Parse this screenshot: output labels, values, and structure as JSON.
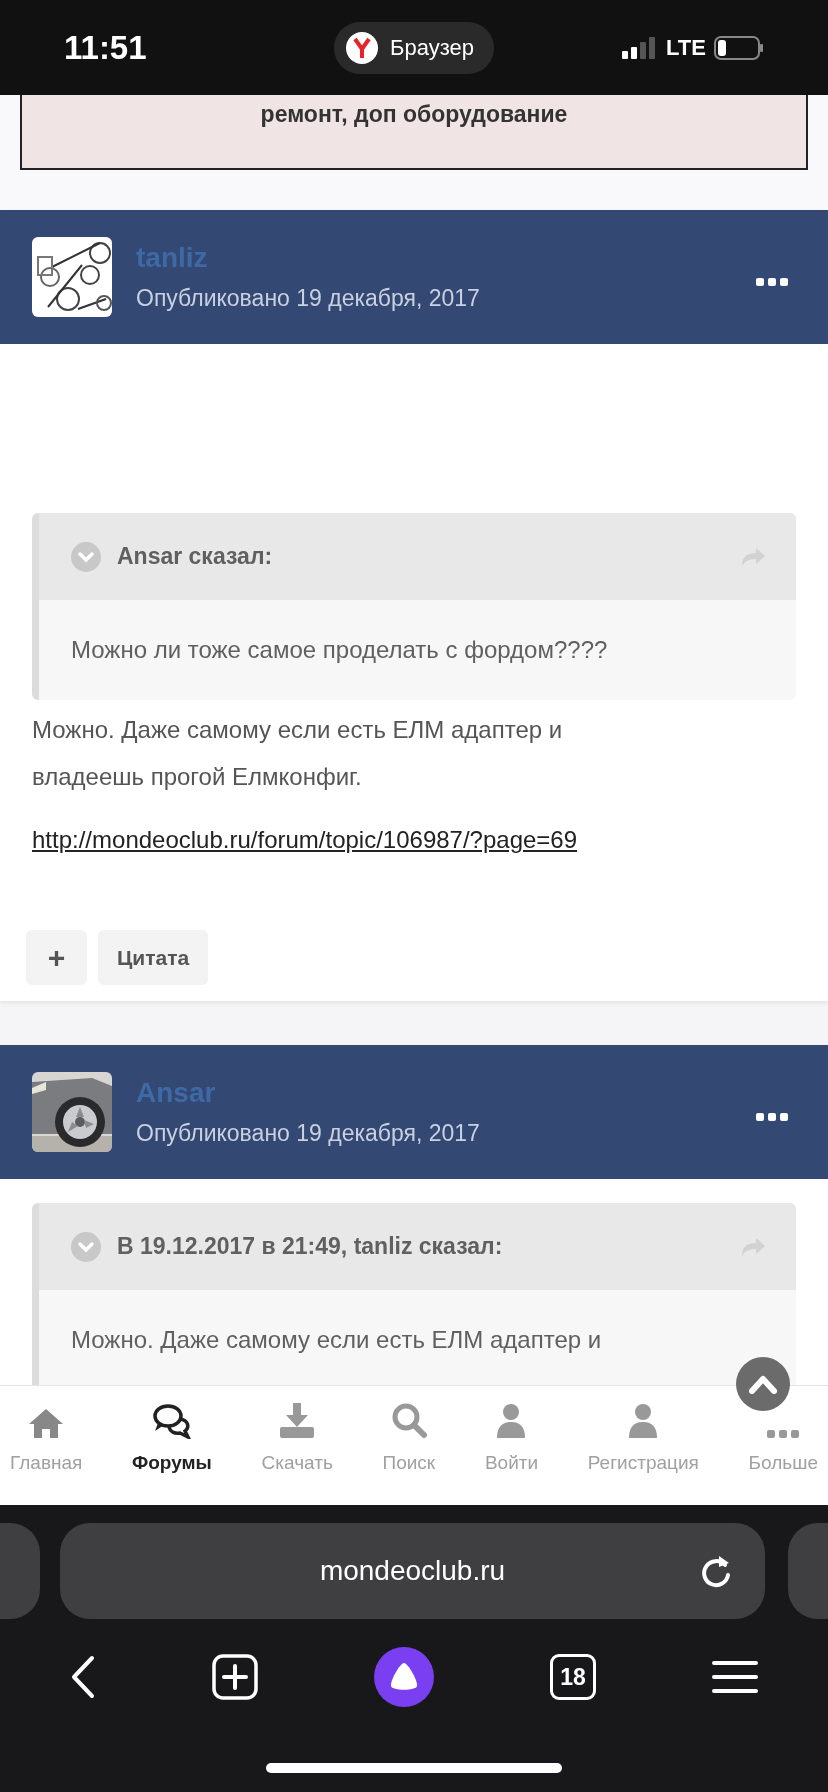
{
  "status_bar": {
    "time": "11:51",
    "app_pill": "Браузер",
    "network": "LTE"
  },
  "banner": {
    "text": "ремонт, доп оборудование"
  },
  "posts": [
    {
      "author": "tanliz",
      "date": "Опубликовано 19 декабря, 2017",
      "quote": {
        "header": "Ansar сказал:",
        "text": "Можно ли тоже самое проделать с фордом????"
      },
      "paragraphs": [
        "Можно. Даже самому если есть ЕЛМ адаптер и владеешь прогой Елмконфиг."
      ],
      "link": "http://mondeoclub.ru/forum/topic/106987/?page=69",
      "actions": [
        "+",
        "Цитата"
      ]
    },
    {
      "author": "Ansar",
      "date": "Опубликовано 19 декабря, 2017",
      "quote": {
        "header": "В 19.12.2017 в 21:49, tanliz сказал:",
        "text": "Можно. Даже самому если есть ЕЛМ адаптер и"
      }
    }
  ],
  "bottom_nav": [
    {
      "label": "Главная",
      "selected": false
    },
    {
      "label": "Форумы",
      "selected": true
    },
    {
      "label": "Скачать",
      "selected": false
    },
    {
      "label": "Поиск",
      "selected": false
    },
    {
      "label": "Войти",
      "selected": false
    },
    {
      "label": "Регистрация",
      "selected": false
    },
    {
      "label": "Больше",
      "selected": false
    }
  ],
  "url_bar": {
    "url": "mondeoclub.ru"
  },
  "toolbar": {
    "tabs_count": "18"
  }
}
